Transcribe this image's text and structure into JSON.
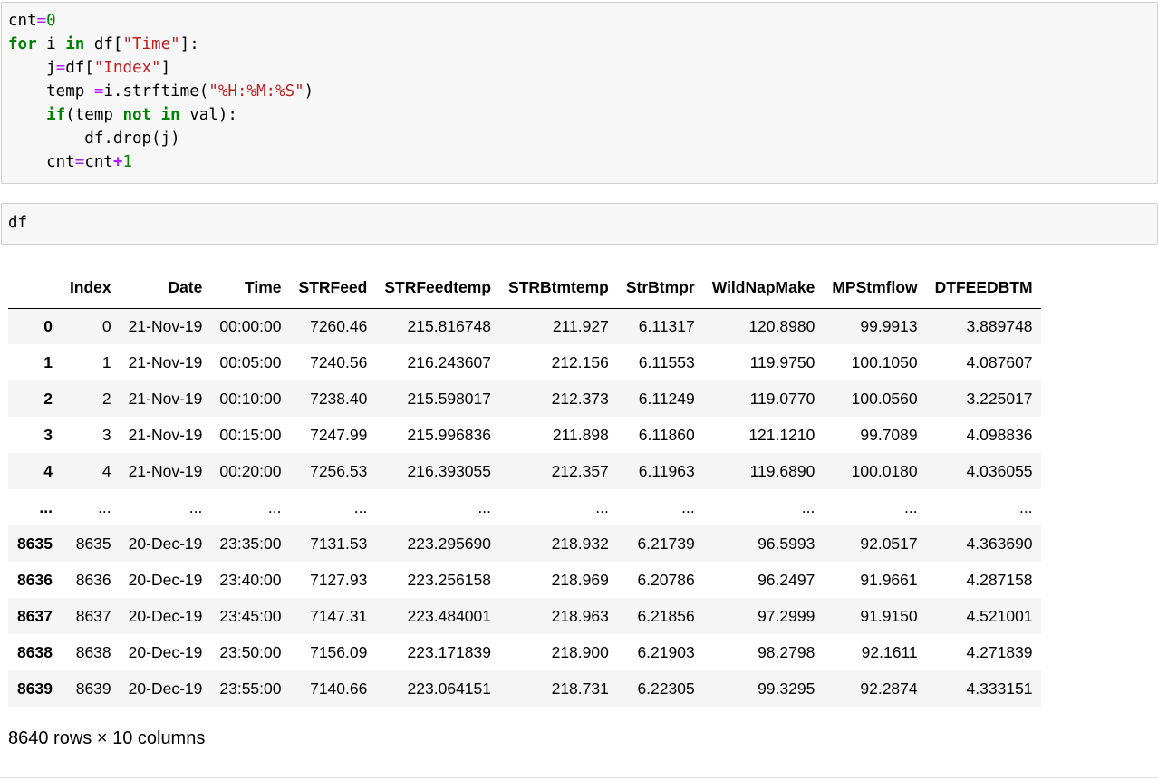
{
  "code_cells": [
    {
      "lines": [
        [
          {
            "t": "text",
            "v": "cnt"
          },
          {
            "t": "op",
            "v": "="
          },
          {
            "t": "num",
            "v": "0"
          }
        ],
        [
          {
            "t": "kw",
            "v": "for"
          },
          {
            "t": "text",
            "v": " i "
          },
          {
            "t": "kw",
            "v": "in"
          },
          {
            "t": "text",
            "v": " df["
          },
          {
            "t": "str",
            "v": "\"Time\""
          },
          {
            "t": "text",
            "v": "]:"
          }
        ],
        [
          {
            "t": "text",
            "v": "    j"
          },
          {
            "t": "op",
            "v": "="
          },
          {
            "t": "text",
            "v": "df["
          },
          {
            "t": "str",
            "v": "\"Index\""
          },
          {
            "t": "text",
            "v": "]"
          }
        ],
        [
          {
            "t": "text",
            "v": "    temp "
          },
          {
            "t": "op",
            "v": "="
          },
          {
            "t": "text",
            "v": "i.strftime("
          },
          {
            "t": "str",
            "v": "\"%H:%M:%S\""
          },
          {
            "t": "text",
            "v": ")"
          }
        ],
        [
          {
            "t": "text",
            "v": "    "
          },
          {
            "t": "kw",
            "v": "if"
          },
          {
            "t": "text",
            "v": "(temp "
          },
          {
            "t": "kw",
            "v": "not"
          },
          {
            "t": "text",
            "v": " "
          },
          {
            "t": "kw",
            "v": "in"
          },
          {
            "t": "text",
            "v": " val):"
          }
        ],
        [
          {
            "t": "text",
            "v": "        df.drop(j)"
          }
        ],
        [
          {
            "t": "text",
            "v": "    cnt"
          },
          {
            "t": "op",
            "v": "="
          },
          {
            "t": "text",
            "v": "cnt"
          },
          {
            "t": "opb",
            "v": "+"
          },
          {
            "t": "num",
            "v": "1"
          }
        ]
      ]
    },
    {
      "lines": [
        [
          {
            "t": "text",
            "v": "df"
          }
        ]
      ]
    }
  ],
  "dataframe": {
    "columns": [
      "",
      "Index",
      "Date",
      "Time",
      "STRFeed",
      "STRFeedtemp",
      "STRBtmtemp",
      "StrBtmpr",
      "WildNapMake",
      "MPStmflow",
      "DTFEEDBTM"
    ],
    "rows": [
      [
        "0",
        "0",
        "21-Nov-19",
        "00:00:00",
        "7260.46",
        "215.816748",
        "211.927",
        "6.11317",
        "120.8980",
        "99.9913",
        "3.889748"
      ],
      [
        "1",
        "1",
        "21-Nov-19",
        "00:05:00",
        "7240.56",
        "216.243607",
        "212.156",
        "6.11553",
        "119.9750",
        "100.1050",
        "4.087607"
      ],
      [
        "2",
        "2",
        "21-Nov-19",
        "00:10:00",
        "7238.40",
        "215.598017",
        "212.373",
        "6.11249",
        "119.0770",
        "100.0560",
        "3.225017"
      ],
      [
        "3",
        "3",
        "21-Nov-19",
        "00:15:00",
        "7247.99",
        "215.996836",
        "211.898",
        "6.11860",
        "121.1210",
        "99.7089",
        "4.098836"
      ],
      [
        "4",
        "4",
        "21-Nov-19",
        "00:20:00",
        "7256.53",
        "216.393055",
        "212.357",
        "6.11963",
        "119.6890",
        "100.0180",
        "4.036055"
      ],
      [
        "...",
        "...",
        "...",
        "...",
        "...",
        "...",
        "...",
        "...",
        "...",
        "...",
        "..."
      ],
      [
        "8635",
        "8635",
        "20-Dec-19",
        "23:35:00",
        "7131.53",
        "223.295690",
        "218.932",
        "6.21739",
        "96.5993",
        "92.0517",
        "4.363690"
      ],
      [
        "8636",
        "8636",
        "20-Dec-19",
        "23:40:00",
        "7127.93",
        "223.256158",
        "218.969",
        "6.20786",
        "96.2497",
        "91.9661",
        "4.287158"
      ],
      [
        "8637",
        "8637",
        "20-Dec-19",
        "23:45:00",
        "7147.31",
        "223.484001",
        "218.963",
        "6.21856",
        "97.2999",
        "91.9150",
        "4.521001"
      ],
      [
        "8638",
        "8638",
        "20-Dec-19",
        "23:50:00",
        "7156.09",
        "223.171839",
        "218.900",
        "6.21903",
        "98.2798",
        "92.1611",
        "4.271839"
      ],
      [
        "8639",
        "8639",
        "20-Dec-19",
        "23:55:00",
        "7140.66",
        "223.064151",
        "218.731",
        "6.22305",
        "99.3295",
        "92.2874",
        "4.333151"
      ]
    ],
    "shape_text": "8640 rows × 10 columns"
  },
  "colors": {
    "keyword": "#008000",
    "operator": "#aa22ff",
    "string": "#ba2121",
    "number": "#008000",
    "cell_background": "#f7f7f7",
    "row_stripe": "#f5f5f5"
  }
}
